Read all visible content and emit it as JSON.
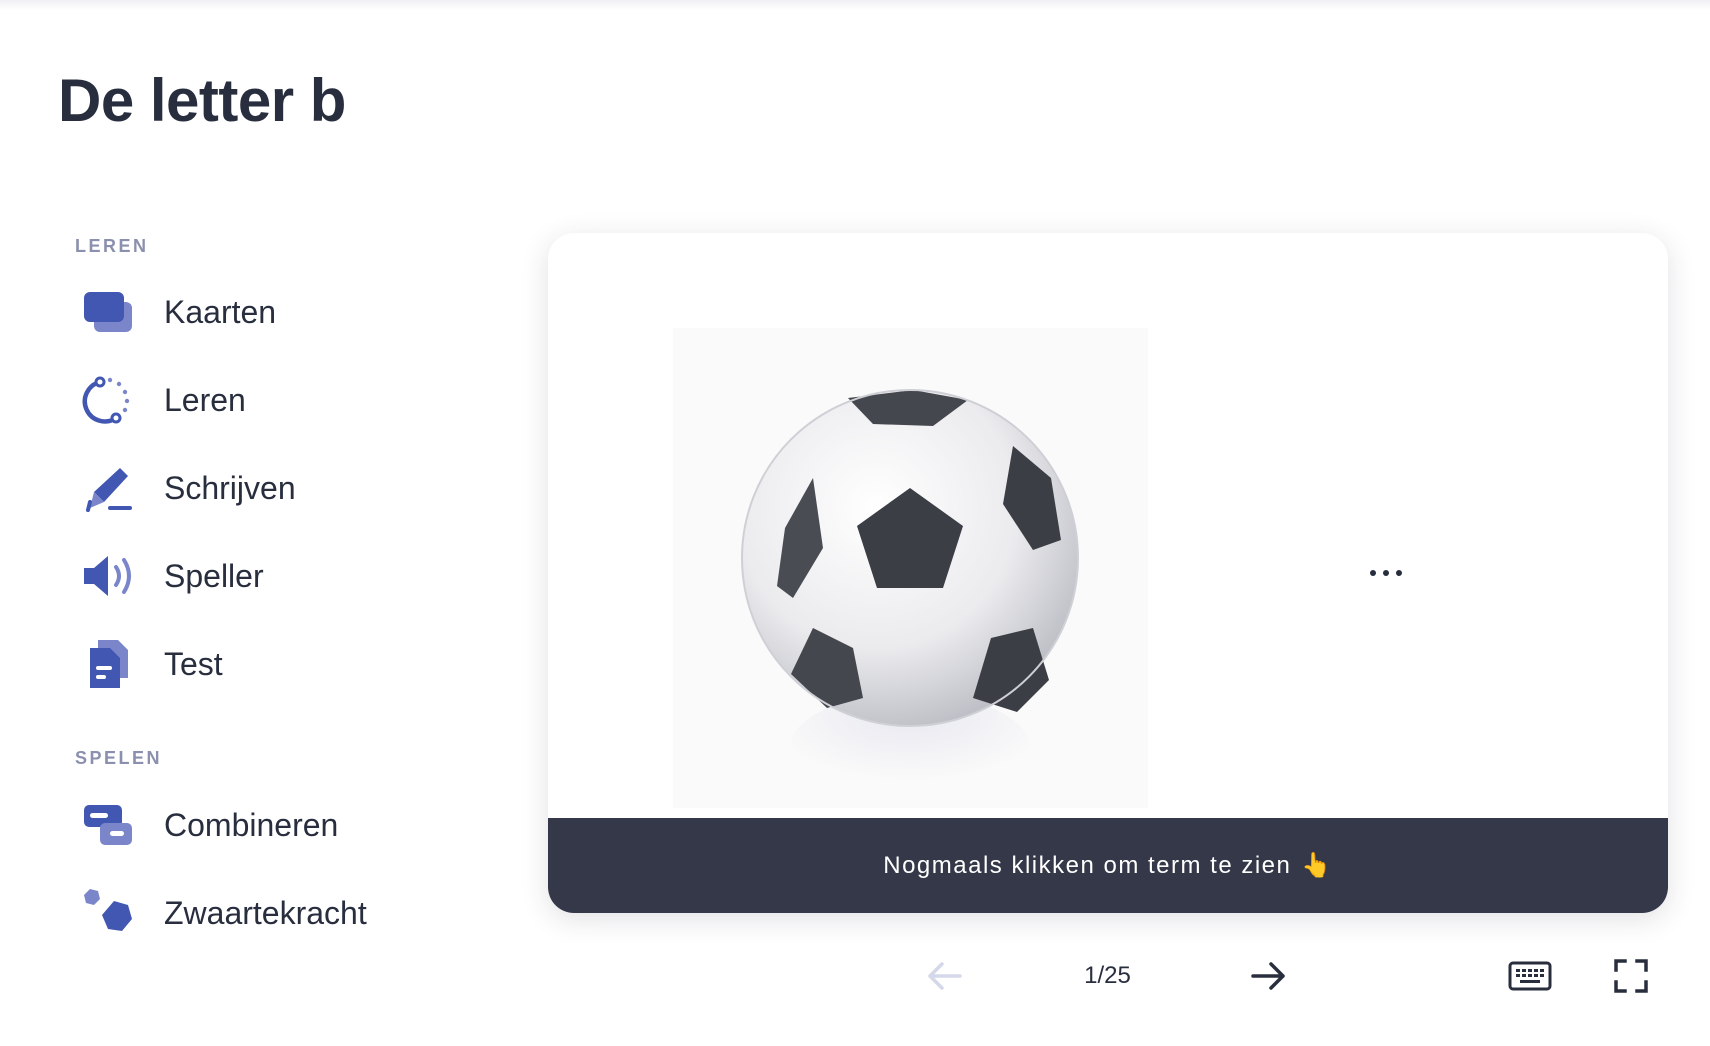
{
  "page": {
    "title": "De letter b"
  },
  "sidebar": {
    "sections": [
      {
        "label": "LEREN",
        "items": [
          {
            "label": "Kaarten",
            "icon": "cards-icon"
          },
          {
            "label": "Leren",
            "icon": "learn-cycle-icon"
          },
          {
            "label": "Schrijven",
            "icon": "write-pen-icon"
          },
          {
            "label": "Speller",
            "icon": "speaker-icon"
          },
          {
            "label": "Test",
            "icon": "test-document-icon"
          }
        ]
      },
      {
        "label": "SPELEN",
        "items": [
          {
            "label": "Combineren",
            "icon": "match-icon"
          },
          {
            "label": "Zwaartekracht",
            "icon": "gravity-icon"
          }
        ]
      }
    ]
  },
  "card": {
    "image": "soccer-ball-image",
    "hint": "Nogmaals klikken om term te zien",
    "hint_emoji": "👆"
  },
  "controls": {
    "counter": "1/25",
    "prev_icon": "arrow-left-icon",
    "next_icon": "arrow-right-icon",
    "keyboard_icon": "keyboard-icon",
    "fullscreen_icon": "fullscreen-icon"
  },
  "colors": {
    "accent": "#4257b2",
    "accent_light": "#7a86c9",
    "text": "#282e3e",
    "hint_bar": "#343848",
    "disabled": "#d5d8e8"
  }
}
